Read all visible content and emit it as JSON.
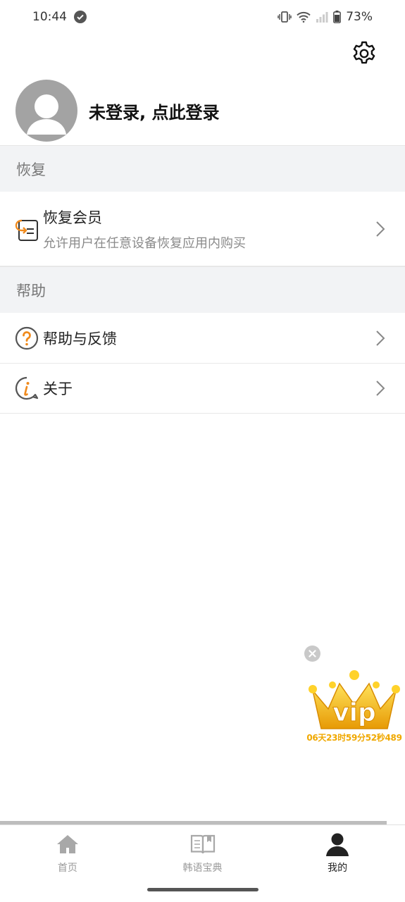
{
  "status_bar": {
    "time": "10:44",
    "battery": "73%"
  },
  "icons": {
    "settings": "gear-icon",
    "avatar": "user-avatar-icon",
    "restore": "restore-member-icon",
    "help": "question-icon",
    "about": "info-icon",
    "chevron": "chevron-right-icon",
    "home": "home-icon",
    "dictionary": "book-icon",
    "mine": "person-icon"
  },
  "profile": {
    "login_prompt": "未登录, 点此登录"
  },
  "sections": {
    "restore": {
      "header": "恢复",
      "items": [
        {
          "title": "恢复会员",
          "subtitle": "允许用户在任意设备恢复应用内购买"
        }
      ]
    },
    "help": {
      "header": "帮助",
      "items": [
        {
          "title": "帮助与反馈"
        },
        {
          "title": "关于"
        }
      ]
    }
  },
  "vip": {
    "label": "vip",
    "countdown": "06天23时59分52秒489"
  },
  "bottom_nav": {
    "items": [
      {
        "label": "首页"
      },
      {
        "label": "韩语宝典"
      },
      {
        "label": "我的"
      }
    ],
    "active_index": 2
  },
  "colors": {
    "section_bg": "#f2f3f5",
    "accent_orange": "#f08a1c",
    "vip_gold": "#f0a800",
    "active_nav": "#222222",
    "inactive_nav": "#9a9a9a"
  }
}
